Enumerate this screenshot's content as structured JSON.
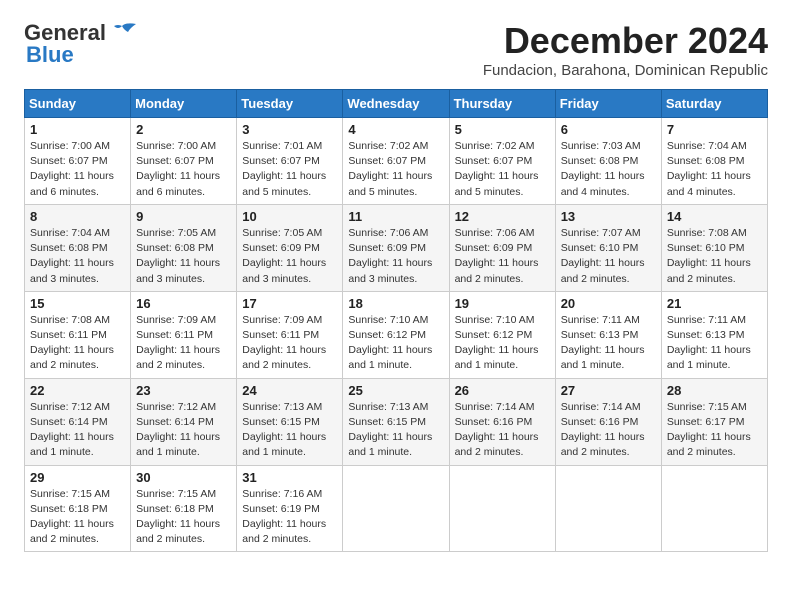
{
  "logo": {
    "part1": "General",
    "part2": "Blue"
  },
  "title": "December 2024",
  "subtitle": "Fundacion, Barahona, Dominican Republic",
  "weekdays": [
    "Sunday",
    "Monday",
    "Tuesday",
    "Wednesday",
    "Thursday",
    "Friday",
    "Saturday"
  ],
  "weeks": [
    [
      {
        "day": "1",
        "info": "Sunrise: 7:00 AM\nSunset: 6:07 PM\nDaylight: 11 hours and 6 minutes."
      },
      {
        "day": "2",
        "info": "Sunrise: 7:00 AM\nSunset: 6:07 PM\nDaylight: 11 hours and 6 minutes."
      },
      {
        "day": "3",
        "info": "Sunrise: 7:01 AM\nSunset: 6:07 PM\nDaylight: 11 hours and 5 minutes."
      },
      {
        "day": "4",
        "info": "Sunrise: 7:02 AM\nSunset: 6:07 PM\nDaylight: 11 hours and 5 minutes."
      },
      {
        "day": "5",
        "info": "Sunrise: 7:02 AM\nSunset: 6:07 PM\nDaylight: 11 hours and 5 minutes."
      },
      {
        "day": "6",
        "info": "Sunrise: 7:03 AM\nSunset: 6:08 PM\nDaylight: 11 hours and 4 minutes."
      },
      {
        "day": "7",
        "info": "Sunrise: 7:04 AM\nSunset: 6:08 PM\nDaylight: 11 hours and 4 minutes."
      }
    ],
    [
      {
        "day": "8",
        "info": "Sunrise: 7:04 AM\nSunset: 6:08 PM\nDaylight: 11 hours and 3 minutes."
      },
      {
        "day": "9",
        "info": "Sunrise: 7:05 AM\nSunset: 6:08 PM\nDaylight: 11 hours and 3 minutes."
      },
      {
        "day": "10",
        "info": "Sunrise: 7:05 AM\nSunset: 6:09 PM\nDaylight: 11 hours and 3 minutes."
      },
      {
        "day": "11",
        "info": "Sunrise: 7:06 AM\nSunset: 6:09 PM\nDaylight: 11 hours and 3 minutes."
      },
      {
        "day": "12",
        "info": "Sunrise: 7:06 AM\nSunset: 6:09 PM\nDaylight: 11 hours and 2 minutes."
      },
      {
        "day": "13",
        "info": "Sunrise: 7:07 AM\nSunset: 6:10 PM\nDaylight: 11 hours and 2 minutes."
      },
      {
        "day": "14",
        "info": "Sunrise: 7:08 AM\nSunset: 6:10 PM\nDaylight: 11 hours and 2 minutes."
      }
    ],
    [
      {
        "day": "15",
        "info": "Sunrise: 7:08 AM\nSunset: 6:11 PM\nDaylight: 11 hours and 2 minutes."
      },
      {
        "day": "16",
        "info": "Sunrise: 7:09 AM\nSunset: 6:11 PM\nDaylight: 11 hours and 2 minutes."
      },
      {
        "day": "17",
        "info": "Sunrise: 7:09 AM\nSunset: 6:11 PM\nDaylight: 11 hours and 2 minutes."
      },
      {
        "day": "18",
        "info": "Sunrise: 7:10 AM\nSunset: 6:12 PM\nDaylight: 11 hours and 1 minute."
      },
      {
        "day": "19",
        "info": "Sunrise: 7:10 AM\nSunset: 6:12 PM\nDaylight: 11 hours and 1 minute."
      },
      {
        "day": "20",
        "info": "Sunrise: 7:11 AM\nSunset: 6:13 PM\nDaylight: 11 hours and 1 minute."
      },
      {
        "day": "21",
        "info": "Sunrise: 7:11 AM\nSunset: 6:13 PM\nDaylight: 11 hours and 1 minute."
      }
    ],
    [
      {
        "day": "22",
        "info": "Sunrise: 7:12 AM\nSunset: 6:14 PM\nDaylight: 11 hours and 1 minute."
      },
      {
        "day": "23",
        "info": "Sunrise: 7:12 AM\nSunset: 6:14 PM\nDaylight: 11 hours and 1 minute."
      },
      {
        "day": "24",
        "info": "Sunrise: 7:13 AM\nSunset: 6:15 PM\nDaylight: 11 hours and 1 minute."
      },
      {
        "day": "25",
        "info": "Sunrise: 7:13 AM\nSunset: 6:15 PM\nDaylight: 11 hours and 1 minute."
      },
      {
        "day": "26",
        "info": "Sunrise: 7:14 AM\nSunset: 6:16 PM\nDaylight: 11 hours and 2 minutes."
      },
      {
        "day": "27",
        "info": "Sunrise: 7:14 AM\nSunset: 6:16 PM\nDaylight: 11 hours and 2 minutes."
      },
      {
        "day": "28",
        "info": "Sunrise: 7:15 AM\nSunset: 6:17 PM\nDaylight: 11 hours and 2 minutes."
      }
    ],
    [
      {
        "day": "29",
        "info": "Sunrise: 7:15 AM\nSunset: 6:18 PM\nDaylight: 11 hours and 2 minutes."
      },
      {
        "day": "30",
        "info": "Sunrise: 7:15 AM\nSunset: 6:18 PM\nDaylight: 11 hours and 2 minutes."
      },
      {
        "day": "31",
        "info": "Sunrise: 7:16 AM\nSunset: 6:19 PM\nDaylight: 11 hours and 2 minutes."
      },
      null,
      null,
      null,
      null
    ]
  ]
}
